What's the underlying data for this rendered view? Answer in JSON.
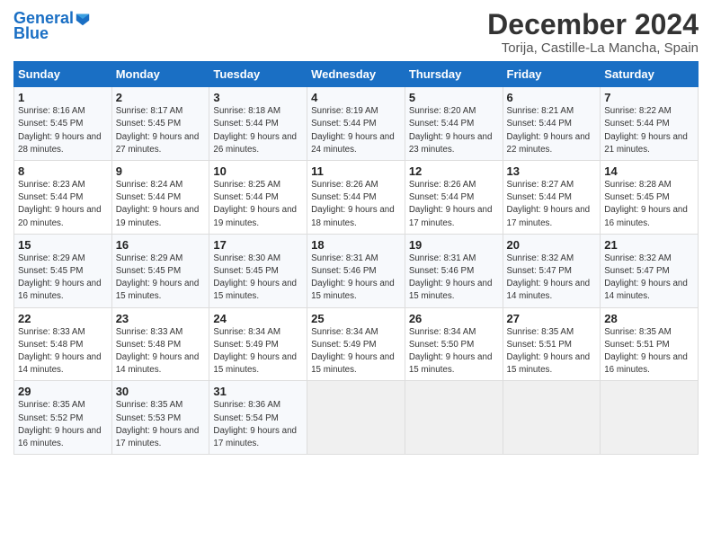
{
  "logo": {
    "text1": "General",
    "text2": "Blue"
  },
  "header": {
    "month": "December 2024",
    "location": "Torija, Castille-La Mancha, Spain"
  },
  "weekdays": [
    "Sunday",
    "Monday",
    "Tuesday",
    "Wednesday",
    "Thursday",
    "Friday",
    "Saturday"
  ],
  "weeks": [
    [
      {
        "day": "1",
        "sunrise": "8:16 AM",
        "sunset": "5:45 PM",
        "daylight": "9 hours and 28 minutes."
      },
      {
        "day": "2",
        "sunrise": "8:17 AM",
        "sunset": "5:45 PM",
        "daylight": "9 hours and 27 minutes."
      },
      {
        "day": "3",
        "sunrise": "8:18 AM",
        "sunset": "5:44 PM",
        "daylight": "9 hours and 26 minutes."
      },
      {
        "day": "4",
        "sunrise": "8:19 AM",
        "sunset": "5:44 PM",
        "daylight": "9 hours and 24 minutes."
      },
      {
        "day": "5",
        "sunrise": "8:20 AM",
        "sunset": "5:44 PM",
        "daylight": "9 hours and 23 minutes."
      },
      {
        "day": "6",
        "sunrise": "8:21 AM",
        "sunset": "5:44 PM",
        "daylight": "9 hours and 22 minutes."
      },
      {
        "day": "7",
        "sunrise": "8:22 AM",
        "sunset": "5:44 PM",
        "daylight": "9 hours and 21 minutes."
      }
    ],
    [
      {
        "day": "8",
        "sunrise": "8:23 AM",
        "sunset": "5:44 PM",
        "daylight": "9 hours and 20 minutes."
      },
      {
        "day": "9",
        "sunrise": "8:24 AM",
        "sunset": "5:44 PM",
        "daylight": "9 hours and 19 minutes."
      },
      {
        "day": "10",
        "sunrise": "8:25 AM",
        "sunset": "5:44 PM",
        "daylight": "9 hours and 19 minutes."
      },
      {
        "day": "11",
        "sunrise": "8:26 AM",
        "sunset": "5:44 PM",
        "daylight": "9 hours and 18 minutes."
      },
      {
        "day": "12",
        "sunrise": "8:26 AM",
        "sunset": "5:44 PM",
        "daylight": "9 hours and 17 minutes."
      },
      {
        "day": "13",
        "sunrise": "8:27 AM",
        "sunset": "5:44 PM",
        "daylight": "9 hours and 17 minutes."
      },
      {
        "day": "14",
        "sunrise": "8:28 AM",
        "sunset": "5:45 PM",
        "daylight": "9 hours and 16 minutes."
      }
    ],
    [
      {
        "day": "15",
        "sunrise": "8:29 AM",
        "sunset": "5:45 PM",
        "daylight": "9 hours and 16 minutes."
      },
      {
        "day": "16",
        "sunrise": "8:29 AM",
        "sunset": "5:45 PM",
        "daylight": "9 hours and 15 minutes."
      },
      {
        "day": "17",
        "sunrise": "8:30 AM",
        "sunset": "5:45 PM",
        "daylight": "9 hours and 15 minutes."
      },
      {
        "day": "18",
        "sunrise": "8:31 AM",
        "sunset": "5:46 PM",
        "daylight": "9 hours and 15 minutes."
      },
      {
        "day": "19",
        "sunrise": "8:31 AM",
        "sunset": "5:46 PM",
        "daylight": "9 hours and 15 minutes."
      },
      {
        "day": "20",
        "sunrise": "8:32 AM",
        "sunset": "5:47 PM",
        "daylight": "9 hours and 14 minutes."
      },
      {
        "day": "21",
        "sunrise": "8:32 AM",
        "sunset": "5:47 PM",
        "daylight": "9 hours and 14 minutes."
      }
    ],
    [
      {
        "day": "22",
        "sunrise": "8:33 AM",
        "sunset": "5:48 PM",
        "daylight": "9 hours and 14 minutes."
      },
      {
        "day": "23",
        "sunrise": "8:33 AM",
        "sunset": "5:48 PM",
        "daylight": "9 hours and 14 minutes."
      },
      {
        "day": "24",
        "sunrise": "8:34 AM",
        "sunset": "5:49 PM",
        "daylight": "9 hours and 15 minutes."
      },
      {
        "day": "25",
        "sunrise": "8:34 AM",
        "sunset": "5:49 PM",
        "daylight": "9 hours and 15 minutes."
      },
      {
        "day": "26",
        "sunrise": "8:34 AM",
        "sunset": "5:50 PM",
        "daylight": "9 hours and 15 minutes."
      },
      {
        "day": "27",
        "sunrise": "8:35 AM",
        "sunset": "5:51 PM",
        "daylight": "9 hours and 15 minutes."
      },
      {
        "day": "28",
        "sunrise": "8:35 AM",
        "sunset": "5:51 PM",
        "daylight": "9 hours and 16 minutes."
      }
    ],
    [
      {
        "day": "29",
        "sunrise": "8:35 AM",
        "sunset": "5:52 PM",
        "daylight": "9 hours and 16 minutes."
      },
      {
        "day": "30",
        "sunrise": "8:35 AM",
        "sunset": "5:53 PM",
        "daylight": "9 hours and 17 minutes."
      },
      {
        "day": "31",
        "sunrise": "8:36 AM",
        "sunset": "5:54 PM",
        "daylight": "9 hours and 17 minutes."
      },
      null,
      null,
      null,
      null
    ]
  ]
}
